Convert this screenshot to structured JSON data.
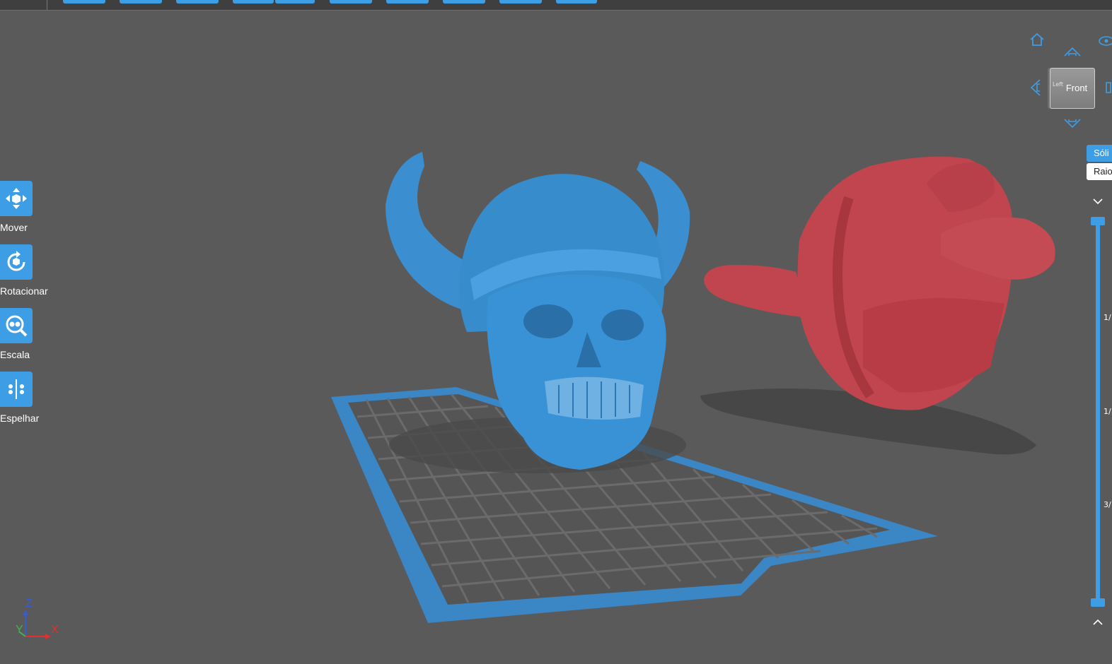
{
  "toolbar": {
    "buttons": [
      "",
      "",
      "",
      "",
      "",
      "",
      "",
      "",
      "",
      ""
    ]
  },
  "left_tools": {
    "move": {
      "label": "Mover",
      "icon": "move-icon"
    },
    "rotate": {
      "label": "Rotacionar",
      "icon": "rotate-icon"
    },
    "scale": {
      "label": "Escala",
      "icon": "scale-icon"
    },
    "mirror": {
      "label": "Espelhar",
      "icon": "mirror-icon"
    }
  },
  "view_cube": {
    "face_label": "Front",
    "side_label": "Left",
    "icons": [
      "home-icon",
      "eye-icon",
      "arrow-up-icon",
      "arrow-left-icon",
      "arrow-right-icon",
      "arrow-down-icon"
    ]
  },
  "render_modes": {
    "solid": "Sóli",
    "xray": "Raio"
  },
  "layer_slider": {
    "ticks": [
      "1/",
      "1/",
      "3/"
    ],
    "expand_icon": "chevron-down-icon",
    "collapse_icon": "chevron-up-icon"
  },
  "axes": {
    "z": "Z",
    "y": "Y",
    "x": "X"
  },
  "colors": {
    "accent": "#3d9ee6",
    "background": "#5a5a5a",
    "model_selected": "#3b8fd0",
    "model_other": "#c1454e",
    "axis_x": "#e03030",
    "axis_y": "#3db84a",
    "axis_z": "#3a5ccc"
  }
}
